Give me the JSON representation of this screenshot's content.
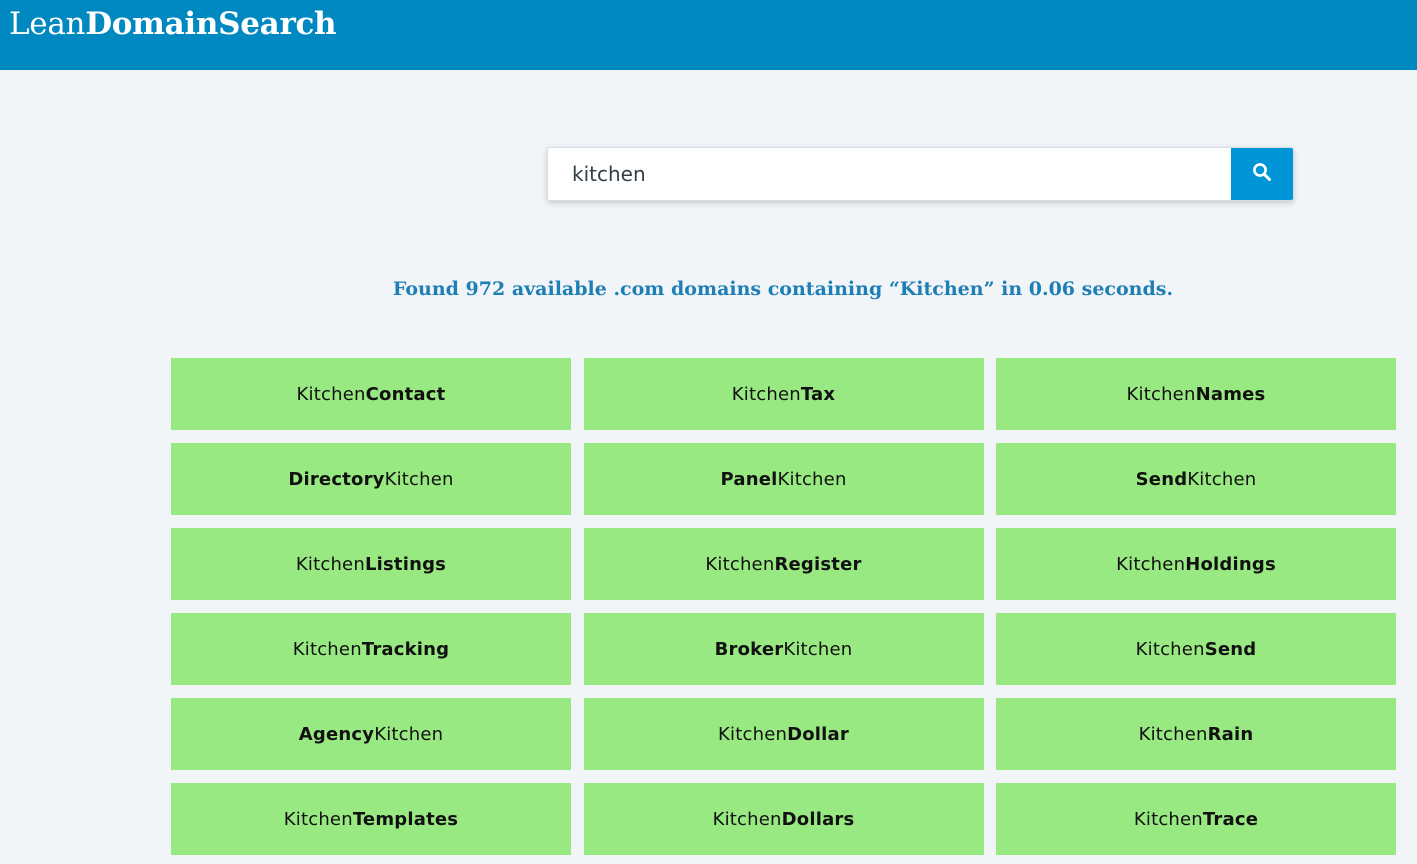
{
  "header": {
    "logo_light": "Lean",
    "logo_bold": "DomainSearch",
    "background_color": "#0088c0"
  },
  "search": {
    "value": "kitchen",
    "button_icon": "search-icon",
    "button_color": "#0095d6"
  },
  "results": {
    "summary": "Found 972 available .com domains containing “Kitchen” in 0.06 seconds.",
    "card_color": "#98e981",
    "domains": [
      {
        "parts": [
          {
            "text": "Kitchen",
            "bold": false
          },
          {
            "text": "Contact",
            "bold": true
          }
        ]
      },
      {
        "parts": [
          {
            "text": "Kitchen",
            "bold": false
          },
          {
            "text": "Tax",
            "bold": true
          }
        ]
      },
      {
        "parts": [
          {
            "text": "Kitchen",
            "bold": false
          },
          {
            "text": "Names",
            "bold": true
          }
        ]
      },
      {
        "parts": [
          {
            "text": "Directory",
            "bold": true
          },
          {
            "text": "Kitchen",
            "bold": false
          }
        ]
      },
      {
        "parts": [
          {
            "text": "Panel",
            "bold": true
          },
          {
            "text": "Kitchen",
            "bold": false
          }
        ]
      },
      {
        "parts": [
          {
            "text": "Send",
            "bold": true
          },
          {
            "text": "Kitchen",
            "bold": false
          }
        ]
      },
      {
        "parts": [
          {
            "text": "Kitchen",
            "bold": false
          },
          {
            "text": "Listings",
            "bold": true
          }
        ]
      },
      {
        "parts": [
          {
            "text": "Kitchen",
            "bold": false
          },
          {
            "text": "Register",
            "bold": true
          }
        ]
      },
      {
        "parts": [
          {
            "text": "Kitchen",
            "bold": false
          },
          {
            "text": "Holdings",
            "bold": true
          }
        ]
      },
      {
        "parts": [
          {
            "text": "Kitchen",
            "bold": false
          },
          {
            "text": "Tracking",
            "bold": true
          }
        ]
      },
      {
        "parts": [
          {
            "text": "Broker",
            "bold": true
          },
          {
            "text": "Kitchen",
            "bold": false
          }
        ]
      },
      {
        "parts": [
          {
            "text": "Kitchen",
            "bold": false
          },
          {
            "text": "Send",
            "bold": true
          }
        ]
      },
      {
        "parts": [
          {
            "text": "Agency",
            "bold": true
          },
          {
            "text": "Kitchen",
            "bold": false
          }
        ]
      },
      {
        "parts": [
          {
            "text": "Kitchen",
            "bold": false
          },
          {
            "text": "Dollar",
            "bold": true
          }
        ]
      },
      {
        "parts": [
          {
            "text": "Kitchen",
            "bold": false
          },
          {
            "text": "Rain",
            "bold": true
          }
        ]
      },
      {
        "parts": [
          {
            "text": "Kitchen",
            "bold": false
          },
          {
            "text": "Templates",
            "bold": true
          }
        ]
      },
      {
        "parts": [
          {
            "text": "Kitchen",
            "bold": false
          },
          {
            "text": "Dollars",
            "bold": true
          }
        ]
      },
      {
        "parts": [
          {
            "text": "Kitchen",
            "bold": false
          },
          {
            "text": "Trace",
            "bold": true
          }
        ]
      }
    ]
  }
}
